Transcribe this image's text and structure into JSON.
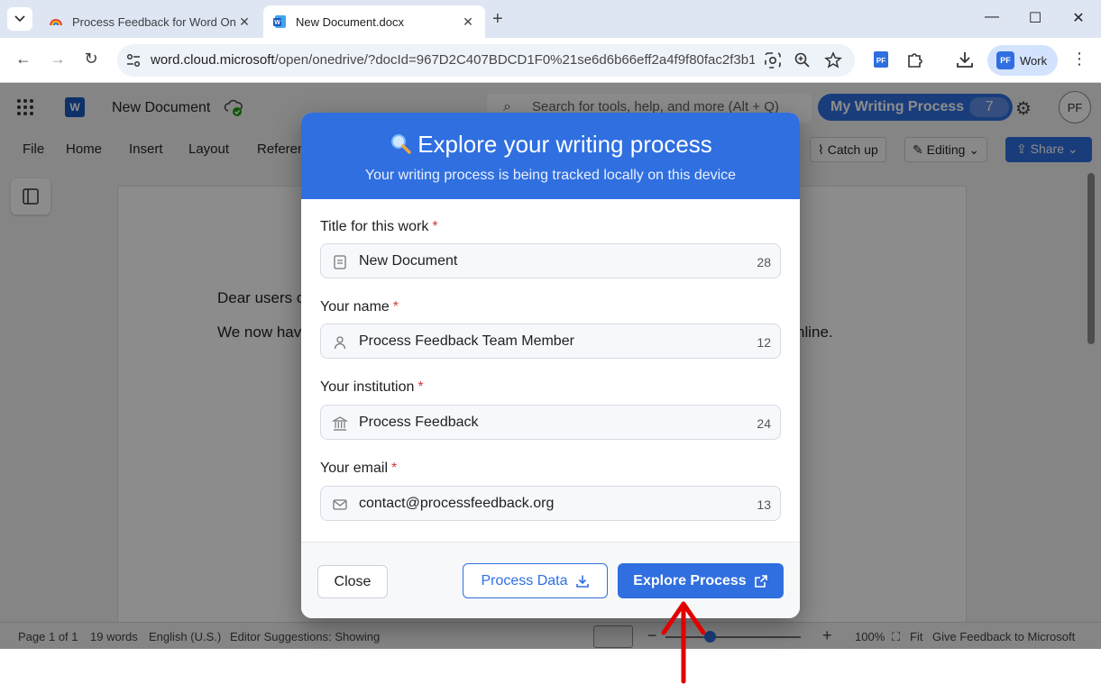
{
  "browser": {
    "tabs": [
      {
        "title": "Process Feedback for Word Onl",
        "active": false
      },
      {
        "title": "New Document.docx",
        "active": true
      }
    ],
    "url_host": "word.cloud.microsoft",
    "url_rest": "/open/onedrive/?docId=967D2C407BDCD1F0%21se6d6b66eff2a4f9f80fac2f3b1...",
    "profile_label": "Work",
    "profile_badge": "PF"
  },
  "word": {
    "app_badge": "W",
    "doc_title": "New Document",
    "search_placeholder": "Search for tools, help, and more (Alt + Q)",
    "writing_process_label": "My Writing Process",
    "writing_process_count": "7",
    "avatar_initials": "PF",
    "ribbon_tabs": [
      "File",
      "Home",
      "Insert",
      "Layout",
      "Referen"
    ],
    "catch_up_label": "Catch up",
    "editing_label": "Editing",
    "share_label": "Share",
    "doc_line1": "Dear users c",
    "doc_line2": "We now hav",
    "doc_line2_end": "nline.",
    "status": {
      "page": "Page 1 of 1",
      "words": "19 words",
      "language": "English (U.S.)",
      "editor": "Editor Suggestions: Showing",
      "zoom": "100%",
      "fit": "Fit",
      "feedback": "Give Feedback to Microsoft"
    }
  },
  "modal": {
    "title": "Explore your writing process",
    "subtitle": "Your writing process is being tracked locally on this device",
    "required_mark": "*",
    "fields": [
      {
        "label": "Title for this work",
        "value": "New Document",
        "count": "28",
        "icon": "document-icon"
      },
      {
        "label": "Your name",
        "value": "Process Feedback Team Member",
        "count": "12",
        "icon": "person-icon"
      },
      {
        "label": "Your institution",
        "value": "Process Feedback",
        "count": "24",
        "icon": "institution-icon"
      },
      {
        "label": "Your email",
        "value": "contact@processfeedback.org",
        "count": "13",
        "icon": "mail-icon"
      }
    ],
    "close_label": "Close",
    "process_data_label": "Process Data",
    "explore_label": "Explore Process",
    "accent_color": "#2f6fe0"
  }
}
